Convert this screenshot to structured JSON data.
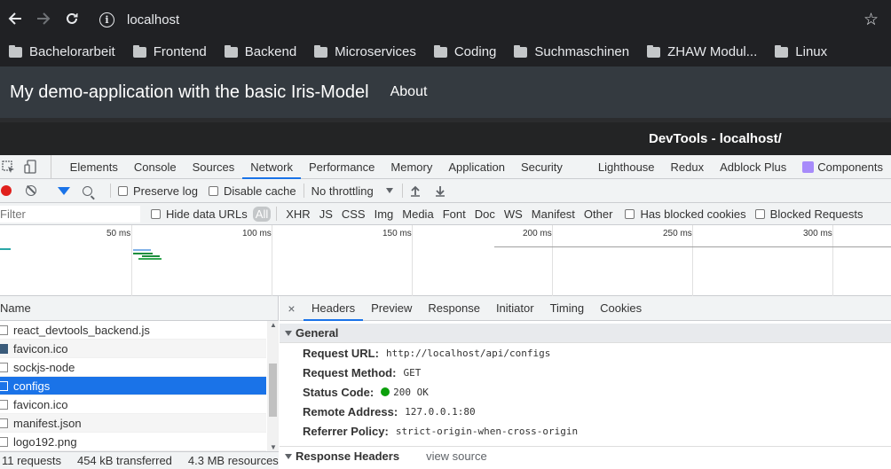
{
  "browser": {
    "url": "localhost",
    "bookmarks": [
      "Bachelorarbeit",
      "Frontend",
      "Backend",
      "Microservices",
      "Coding",
      "Suchmaschinen",
      "ZHAW Modul...",
      "Linux"
    ]
  },
  "app": {
    "brand": "My demo-application with the basic Iris-Model",
    "nav_about": "About"
  },
  "devtools": {
    "title": "DevTools - localhost/",
    "tabs": [
      "Elements",
      "Console",
      "Sources",
      "Network",
      "Performance",
      "Memory",
      "Application",
      "Security",
      "Lighthouse",
      "Redux",
      "Adblock Plus",
      "Components"
    ],
    "active_tab": "Network",
    "toolbar": {
      "preserve_log": "Preserve log",
      "disable_cache": "Disable cache",
      "throttling": "No throttling"
    },
    "filter": {
      "placeholder": "Filter",
      "hide_data_urls": "Hide data URLs",
      "types": [
        "All",
        "XHR",
        "JS",
        "CSS",
        "Img",
        "Media",
        "Font",
        "Doc",
        "WS",
        "Manifest",
        "Other"
      ],
      "has_blocked_cookies": "Has blocked cookies",
      "blocked_requests": "Blocked Requests"
    },
    "timeline": {
      "ticks": [
        "50 ms",
        "100 ms",
        "150 ms",
        "200 ms",
        "250 ms",
        "300 ms"
      ]
    },
    "requests": {
      "column": "Name",
      "rows": [
        "react_devtools_backend.js",
        "favicon.ico",
        "sockjs-node",
        "configs",
        "favicon.ico",
        "manifest.json",
        "logo192.png"
      ],
      "selected": "configs"
    },
    "status": {
      "requests": "11 requests",
      "transferred": "454 kB transferred",
      "resources": "4.3 MB resources"
    },
    "detail": {
      "close": "×",
      "tabs": [
        "Headers",
        "Preview",
        "Response",
        "Initiator",
        "Timing",
        "Cookies"
      ],
      "general_title": "General",
      "request_url_label": "Request URL:",
      "request_url": "http://localhost/api/configs",
      "request_method_label": "Request Method:",
      "request_method": "GET",
      "status_code_label": "Status Code:",
      "status_code": "200 OK",
      "remote_address_label": "Remote Address:",
      "remote_address": "127.0.0.1:80",
      "referrer_policy_label": "Referrer Policy:",
      "referrer_policy": "strict-origin-when-cross-origin",
      "response_headers_title": "Response Headers",
      "view_source": "view source"
    }
  }
}
